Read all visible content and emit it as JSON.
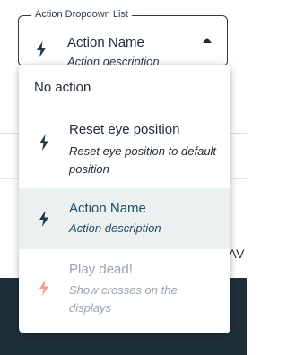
{
  "background": {
    "partial_text": "AV"
  },
  "field": {
    "legend": "Action Dropdown List",
    "selected_name": "Action Name",
    "selected_description": "Action description",
    "icon": "lightning-icon"
  },
  "menu": {
    "none_label": "No action",
    "options": [
      {
        "name": "Reset eye position",
        "description": "Reset eye position to default position",
        "icon": "lightning-icon",
        "icon_color": "#1f3342",
        "state": "enabled"
      },
      {
        "name": "Action Name",
        "description": "Action description",
        "icon": "lightning-icon",
        "icon_color": "#1f3342",
        "state": "selected"
      },
      {
        "name": "Play dead!",
        "description": "Show crosses on the displays",
        "icon": "lightning-icon",
        "icon_color": "#ef9c90",
        "state": "disabled"
      }
    ]
  },
  "colors": {
    "selected_background": "#ebf0f1",
    "selected_text": "#1f4a66",
    "disabled_text": "#9aa3a9",
    "footer_background": "#1f2f3a"
  }
}
